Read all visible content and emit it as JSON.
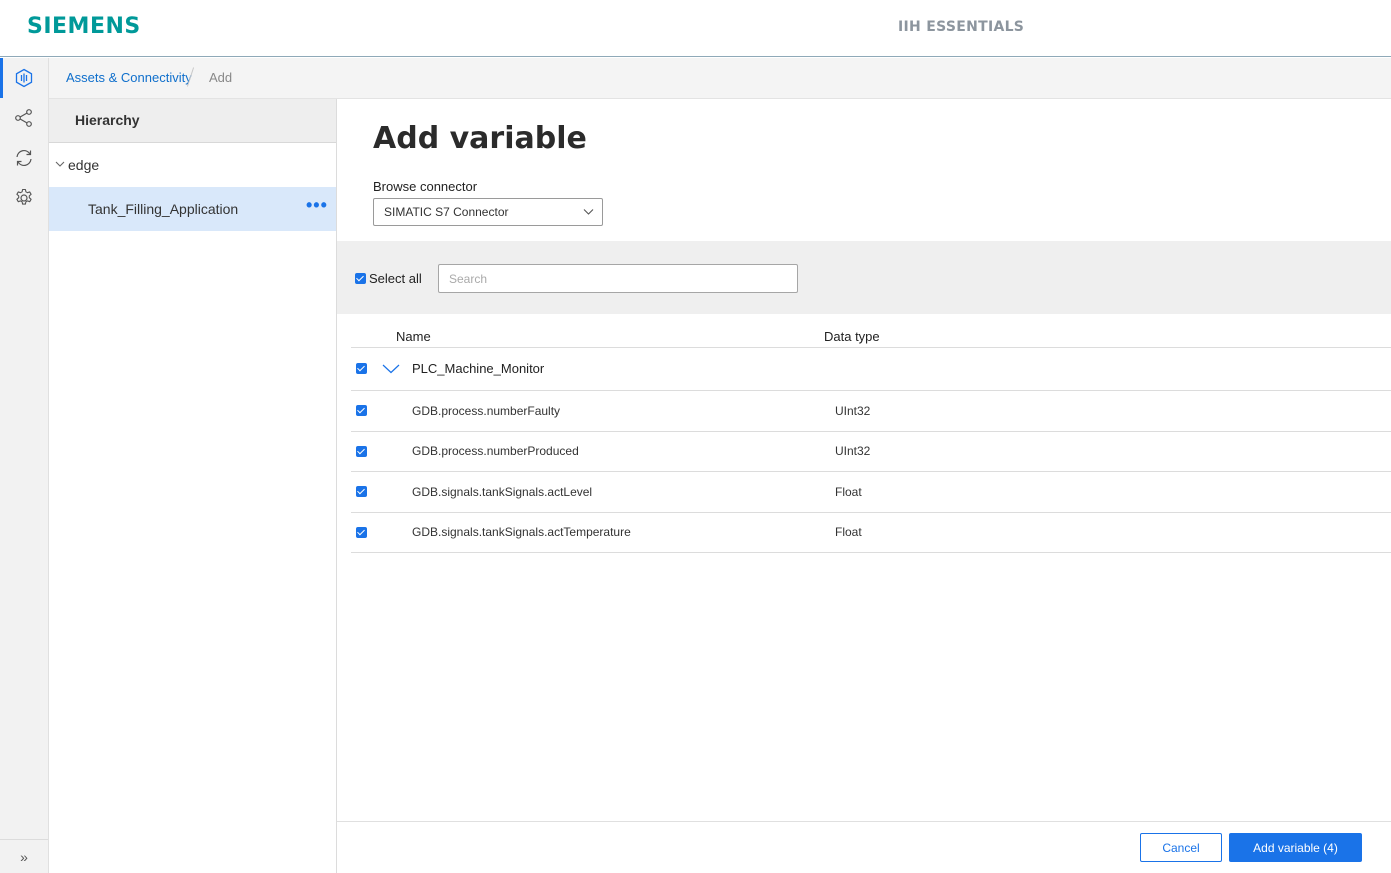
{
  "header": {
    "logo": "SIEMENS",
    "app_title": "IIH ESSENTIALS"
  },
  "rail": {
    "icons": [
      "assets-icon",
      "share-icon",
      "sync-icon",
      "gear-icon"
    ],
    "expand_glyph": "»"
  },
  "breadcrumb": {
    "parent": "Assets & Connectivity",
    "current": "Add"
  },
  "hierarchy": {
    "title": "Hierarchy",
    "root": "edge",
    "selected": "Tank_Filling_Application",
    "more_glyph": "•••"
  },
  "main": {
    "title": "Add variable",
    "connector_label": "Browse connector",
    "connector_value": "SIMATIC S7 Connector",
    "select_all_label": "Select all",
    "search_placeholder": "Search",
    "columns": {
      "name": "Name",
      "type": "Data type"
    },
    "group": "PLC_Machine_Monitor",
    "rows": [
      {
        "name": "GDB.process.numberFaulty",
        "type": "UInt32"
      },
      {
        "name": "GDB.process.numberProduced",
        "type": "UInt32"
      },
      {
        "name": "GDB.signals.tankSignals.actLevel",
        "type": "Float"
      },
      {
        "name": "GDB.signals.tankSignals.actTemperature",
        "type": "Float"
      }
    ],
    "cancel_label": "Cancel",
    "add_label": "Add variable (4)"
  },
  "colors": {
    "brand": "#009999",
    "accent": "#1a73e8",
    "selected_row": "#d9e8fa"
  }
}
